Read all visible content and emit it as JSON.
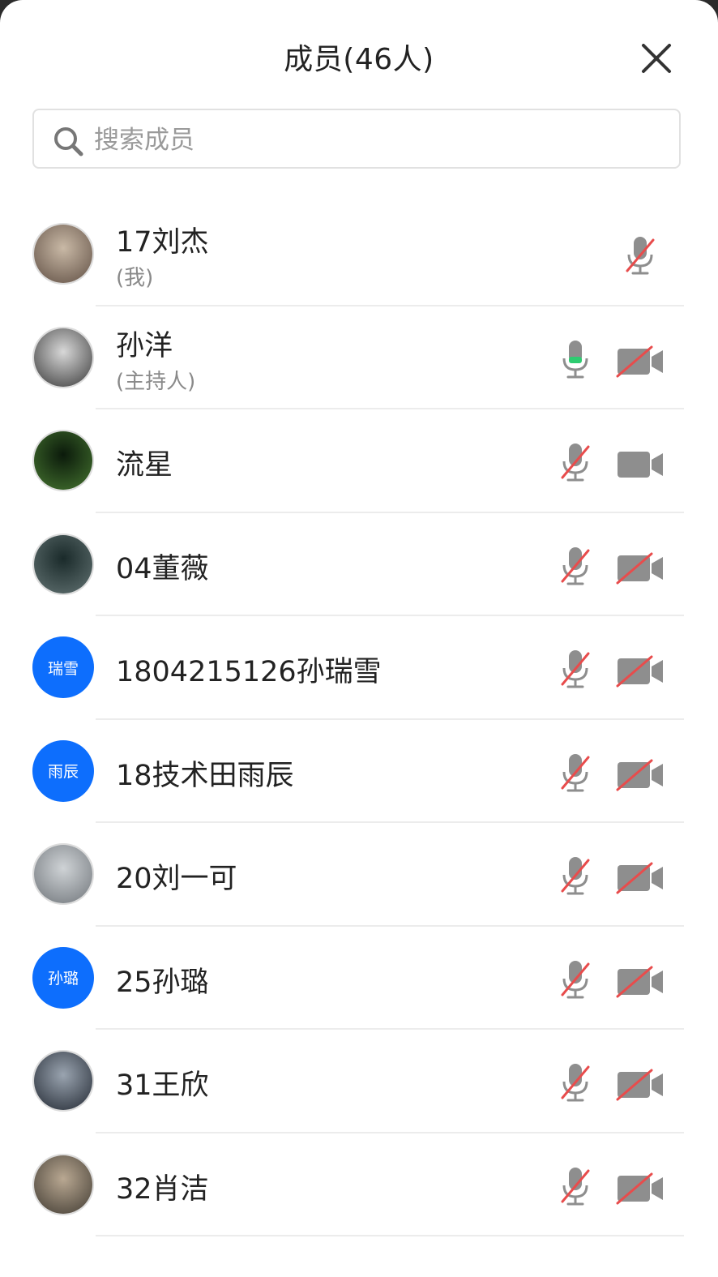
{
  "header": {
    "title": "成员(46人)"
  },
  "search": {
    "placeholder": "搜索成员"
  },
  "colors": {
    "accent_blue": "#0d6efd",
    "muted_red": "#e84c4c",
    "icon_gray": "#8e8e8e",
    "mic_active_green": "#2ecc71"
  },
  "members": [
    {
      "name": "17刘杰",
      "role": "(我)",
      "avatar_text": "",
      "mic": "muted",
      "camera": "none"
    },
    {
      "name": "孙洋",
      "role": "(主持人)",
      "avatar_text": "",
      "mic": "on",
      "camera": "off"
    },
    {
      "name": "流星",
      "role": "",
      "avatar_text": "",
      "mic": "muted",
      "camera": "on"
    },
    {
      "name": "04董薇",
      "role": "",
      "avatar_text": "",
      "mic": "muted",
      "camera": "off"
    },
    {
      "name": "1804215126孙瑞雪",
      "role": "",
      "avatar_text": "瑞雪",
      "mic": "muted",
      "camera": "off"
    },
    {
      "name": "18技术田雨辰",
      "role": "",
      "avatar_text": "雨辰",
      "mic": "muted",
      "camera": "off"
    },
    {
      "name": "20刘一可",
      "role": "",
      "avatar_text": "",
      "mic": "muted",
      "camera": "off"
    },
    {
      "name": "25孙璐",
      "role": "",
      "avatar_text": "孙璐",
      "mic": "muted",
      "camera": "off"
    },
    {
      "name": "31王欣",
      "role": "",
      "avatar_text": "",
      "mic": "muted",
      "camera": "off"
    },
    {
      "name": "32肖洁",
      "role": "",
      "avatar_text": "",
      "mic": "muted",
      "camera": "off"
    }
  ]
}
